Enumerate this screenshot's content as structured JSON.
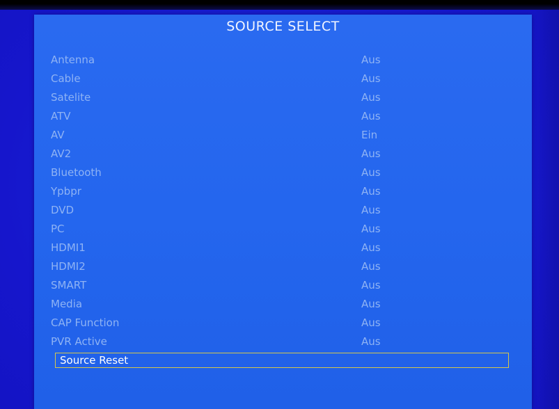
{
  "menu": {
    "title": "SOURCE SELECT",
    "items": [
      {
        "label": "Antenna",
        "value": "Aus"
      },
      {
        "label": "Cable",
        "value": "Aus"
      },
      {
        "label": "Satelite",
        "value": "Aus"
      },
      {
        "label": "ATV",
        "value": "Aus"
      },
      {
        "label": "AV",
        "value": "Ein"
      },
      {
        "label": "AV2",
        "value": "Aus"
      },
      {
        "label": "Bluetooth",
        "value": "Aus"
      },
      {
        "label": "Ypbpr",
        "value": "Aus"
      },
      {
        "label": "DVD",
        "value": "Aus"
      },
      {
        "label": "PC",
        "value": "Aus"
      },
      {
        "label": "HDMI1",
        "value": "Aus"
      },
      {
        "label": "HDMI2",
        "value": "Aus"
      },
      {
        "label": "SMART",
        "value": "Aus"
      },
      {
        "label": "Media",
        "value": "Aus"
      },
      {
        "label": "CAP Function",
        "value": "Aus"
      },
      {
        "label": "PVR Active",
        "value": "Aus"
      }
    ],
    "selected_item": "Source Reset"
  },
  "colors": {
    "screen_background": "#1616d8",
    "menu_background": "#2466ee",
    "item_text": "#8fb3f4",
    "title_text": "#f2f5ff",
    "selection_border": "#d6c84a"
  }
}
